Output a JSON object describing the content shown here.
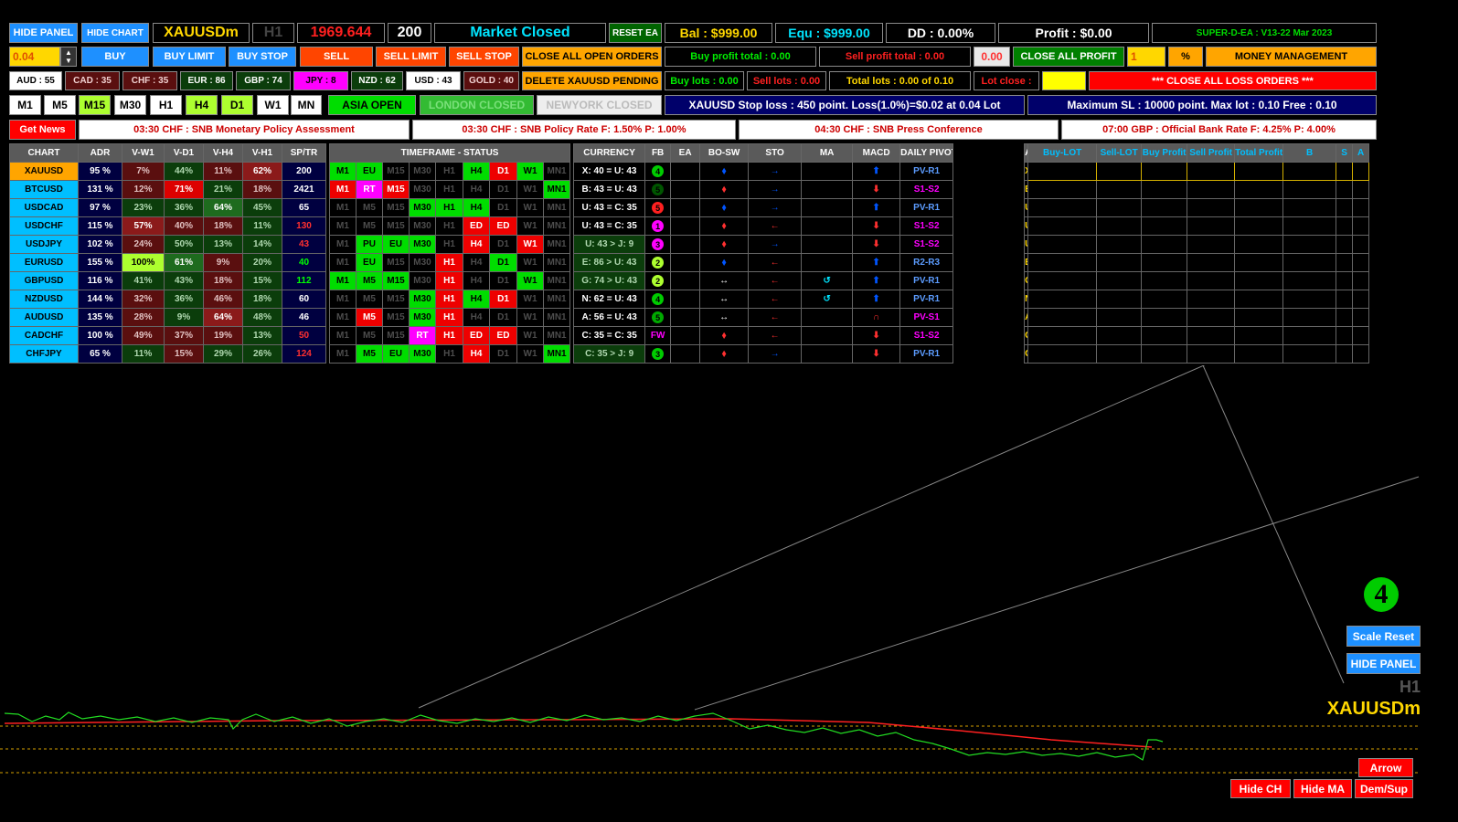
{
  "top": {
    "hide_panel": "HIDE PANEL",
    "hide_chart": "HIDE CHART",
    "symbol": "XAUUSDm",
    "tf": "H1",
    "price": "1969.644",
    "spread": "200",
    "market": "Market Closed",
    "reset_ea": "RESET EA",
    "bal": "Bal : $999.00",
    "equ": "Equ : $999.00",
    "dd": "DD : 0.00%",
    "profit": "Profit : $0.00",
    "version": "SUPER-D-EA : V13-22 Mar 2023"
  },
  "row2": {
    "lot": "0.04",
    "buy": "BUY",
    "buy_limit": "BUY LIMIT",
    "buy_stop": "BUY STOP",
    "sell": "SELL",
    "sell_limit": "SELL LIMIT",
    "sell_stop": "SELL STOP",
    "close_all_open": "CLOSE ALL OPEN ORDERS",
    "buy_profit_total": "Buy profit total : 0.00",
    "sell_profit_total": "Sell profit total : 0.00",
    "amount": "0.00",
    "close_all_profit": "CLOSE ALL PROFIT",
    "pct_value": "1",
    "pct": "%",
    "money_mgmt": "MONEY MANAGEMENT"
  },
  "row3": {
    "currencies": [
      "AUD : 55",
      "CAD : 35",
      "CHF : 35",
      "EUR : 86",
      "GBP : 74",
      "JPY : 8",
      "NZD : 62",
      "USD : 43",
      "GOLD : 40"
    ],
    "delete_pending": "DELETE XAUUSD PENDING",
    "buy_lots": "Buy lots : 0.00",
    "sell_lots": "Sell lots : 0.00",
    "total_lots": "Total lots : 0.00 of 0.10",
    "lot_close": "Lot close :",
    "close_all_loss": "*** CLOSE ALL LOSS ORDERS ***"
  },
  "row4": {
    "tfs": [
      "M1",
      "M5",
      "M15",
      "M30",
      "H1",
      "H4",
      "D1",
      "W1",
      "MN"
    ],
    "asia": "ASIA OPEN",
    "london": "LONDON CLOSED",
    "newyork": "NEWYORK CLOSED",
    "stoploss": "XAUUSD Stop loss : 450 point. Loss(1.0%)=$0.02 at 0.04 Lot",
    "maxsl": "Maximum SL : 10000 point. Max lot : 0.10 Free : 0.10"
  },
  "news": {
    "btn": "Get News",
    "items": [
      "03:30 CHF : SNB Monetary Policy Assessment",
      "03:30 CHF : SNB Policy Rate  F: 1.50% P: 1.00%",
      "04:30 CHF : SNB Press Conference",
      "07:00 GBP : Official Bank Rate  F: 4.25% P: 4.00%"
    ]
  },
  "table": {
    "headers": [
      "CHART",
      "ADR",
      "V-W1",
      "V-D1",
      "V-H4",
      "V-H1",
      "SP/TR",
      "TIMEFRAME -  STATUS",
      "CURRENCY",
      "FB",
      "EA",
      "BO-SW",
      "STO",
      "MA",
      "MACD",
      "DAILY PIVOT",
      "AUTO EA",
      "Buy-LOT",
      "Sell-LOT",
      "Buy Profit",
      "Sell Profit",
      "Total Profit",
      "B",
      "S",
      "A"
    ],
    "tf_labels": [
      "M1",
      "M5",
      "M15",
      "M30",
      "H1",
      "H4",
      "D1",
      "W1",
      "MN1"
    ],
    "rows": [
      {
        "sym": "XAUUSD",
        "adr": "95 %",
        "w1": "7%",
        "d1": "44%",
        "h4": "11%",
        "h1": "62%",
        "sp": "200",
        "tf": [
          "M1",
          "EU",
          "M15",
          "M30",
          "H1",
          "H4",
          "D1",
          "W1",
          "MN1"
        ],
        "cur": "X: 40 = U: 43",
        "fb": "4",
        "bo": "⬧",
        "sto": "→",
        "ma": "",
        "macd": "⬆",
        "pivot": "PV-R1"
      },
      {
        "sym": "BTCUSD",
        "adr": "131 %",
        "w1": "12%",
        "d1": "71%",
        "h4": "21%",
        "h1": "18%",
        "sp": "2421",
        "tf": [
          "M1",
          "RT",
          "M15",
          "M30",
          "H1",
          "H4",
          "D1",
          "W1",
          "MN1"
        ],
        "cur": "B: 43 = U: 43",
        "fb": "5",
        "bo": "⬧",
        "sto": "→",
        "ma": "",
        "macd": "⬇",
        "pivot": "S1-S2"
      },
      {
        "sym": "USDCAD",
        "adr": "97 %",
        "w1": "23%",
        "d1": "36%",
        "h4": "64%",
        "h1": "45%",
        "sp": "65",
        "tf": [
          "M1",
          "M5",
          "M15",
          "M30",
          "H1",
          "H4",
          "D1",
          "W1",
          "MN1"
        ],
        "cur": "U: 43 = C: 35",
        "fb": "5",
        "bo": "⬧",
        "sto": "→",
        "ma": "",
        "macd": "⬆",
        "pivot": "PV-R1"
      },
      {
        "sym": "USDCHF",
        "adr": "115 %",
        "w1": "57%",
        "d1": "40%",
        "h4": "18%",
        "h1": "11%",
        "sp": "130",
        "tf": [
          "M1",
          "M5",
          "M15",
          "M30",
          "H1",
          "ED",
          "ED",
          "W1",
          "MN1"
        ],
        "cur": "U: 43 = C: 35",
        "fb": "1",
        "bo": "⬧",
        "sto": "←",
        "ma": "",
        "macd": "⬇",
        "pivot": "S1-S2"
      },
      {
        "sym": "USDJPY",
        "adr": "102 %",
        "w1": "24%",
        "d1": "50%",
        "h4": "13%",
        "h1": "14%",
        "sp": "43",
        "tf": [
          "M1",
          "PU",
          "EU",
          "M30",
          "H1",
          "H4",
          "D1",
          "W1",
          "MN1"
        ],
        "cur": "U: 43 > J: 9",
        "fb": "3",
        "bo": "⬧",
        "sto": "→",
        "ma": "",
        "macd": "⬇",
        "pivot": "S1-S2"
      },
      {
        "sym": "EURUSD",
        "adr": "155 %",
        "w1": "100%",
        "d1": "61%",
        "h4": "9%",
        "h1": "20%",
        "sp": "40",
        "tf": [
          "M1",
          "EU",
          "M15",
          "M30",
          "H1",
          "H4",
          "D1",
          "W1",
          "MN1"
        ],
        "cur": "E: 86 > U: 43",
        "fb": "2",
        "bo": "⬧",
        "sto": "←",
        "ma": "",
        "macd": "⬆",
        "pivot": "R2-R3"
      },
      {
        "sym": "GBPUSD",
        "adr": "116 %",
        "w1": "41%",
        "d1": "43%",
        "h4": "18%",
        "h1": "15%",
        "sp": "112",
        "tf": [
          "M1",
          "M5",
          "M15",
          "M30",
          "H1",
          "H4",
          "D1",
          "W1",
          "MN1"
        ],
        "cur": "G: 74 > U: 43",
        "fb": "2",
        "bo": "↔",
        "sto": "←",
        "ma": "↺",
        "macd": "⬆",
        "pivot": "PV-R1"
      },
      {
        "sym": "NZDUSD",
        "adr": "144 %",
        "w1": "32%",
        "d1": "36%",
        "h4": "46%",
        "h1": "18%",
        "sp": "60",
        "tf": [
          "M1",
          "M5",
          "M15",
          "M30",
          "H1",
          "H4",
          "D1",
          "W1",
          "MN1"
        ],
        "cur": "N: 62 = U: 43",
        "fb": "4",
        "bo": "↔",
        "sto": "←",
        "ma": "↺",
        "macd": "⬆",
        "pivot": "PV-R1"
      },
      {
        "sym": "AUDUSD",
        "adr": "135 %",
        "w1": "28%",
        "d1": "9%",
        "h4": "64%",
        "h1": "48%",
        "sp": "46",
        "tf": [
          "M1",
          "M5",
          "M15",
          "M30",
          "H1",
          "H4",
          "D1",
          "W1",
          "MN1"
        ],
        "cur": "A: 56 = U: 43",
        "fb": "5",
        "bo": "↔",
        "sto": "←",
        "ma": "",
        "macd": "∩",
        "pivot": "PV-S1"
      },
      {
        "sym": "CADCHF",
        "adr": "100 %",
        "w1": "49%",
        "d1": "37%",
        "h4": "19%",
        "h1": "13%",
        "sp": "50",
        "tf": [
          "M1",
          "M5",
          "M15",
          "RT",
          "H1",
          "ED",
          "ED",
          "W1",
          "MN1"
        ],
        "cur": "C: 35 = C: 35",
        "fb": "FW",
        "bo": "⬧",
        "sto": "←",
        "ma": "",
        "macd": "⬇",
        "pivot": "S1-S2"
      },
      {
        "sym": "CHFJPY",
        "adr": "65 %",
        "w1": "11%",
        "d1": "15%",
        "h4": "29%",
        "h1": "26%",
        "sp": "124",
        "tf": [
          "M1",
          "M5",
          "EU",
          "M30",
          "H1",
          "H4",
          "D1",
          "W1",
          "MN1"
        ],
        "cur": "C: 35 > J: 9",
        "fb": "3",
        "bo": "⬧",
        "sto": "→",
        "ma": "",
        "macd": "⬇",
        "pivot": "PV-R1"
      }
    ]
  },
  "side": {
    "big_num": "4",
    "scale_reset": "Scale Reset",
    "hide_panel": "HIDE PANEL",
    "tf": "H1",
    "symbol": "XAUUSDm",
    "arrow": "Arrow",
    "hide_ch": "Hide CH",
    "hide_ma": "Hide MA",
    "dem_sup": "Dem/Sup"
  },
  "colors": {
    "accent_blue": "#1e90ff",
    "sell_orange": "#ff4500",
    "gold": "#ffd700",
    "profit_green": "#00cc00",
    "loss_red": "#ff0000"
  }
}
